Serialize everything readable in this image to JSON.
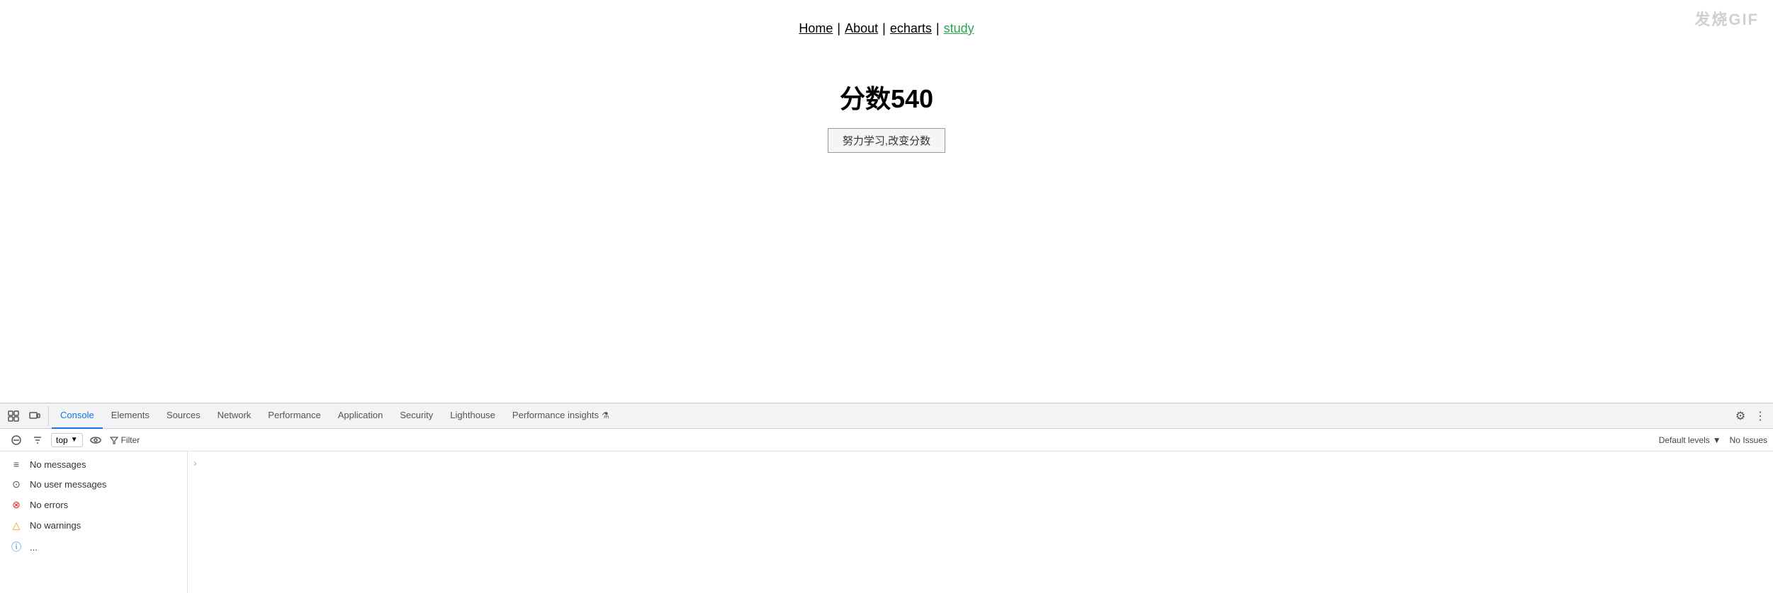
{
  "watermark": {
    "text": "发烧GIF"
  },
  "nav": {
    "links": [
      {
        "label": "Home",
        "class": "normal"
      },
      {
        "sep": "|"
      },
      {
        "label": "About",
        "class": "normal"
      },
      {
        "sep": "|"
      },
      {
        "label": "echarts",
        "class": "normal"
      },
      {
        "sep": "|"
      },
      {
        "label": "study",
        "class": "study"
      }
    ]
  },
  "score": {
    "title": "分数540",
    "button_label": "努力学习,改变分数"
  },
  "devtools": {
    "tabs": [
      {
        "label": "Console",
        "active": true
      },
      {
        "label": "Elements",
        "active": false
      },
      {
        "label": "Sources",
        "active": false
      },
      {
        "label": "Network",
        "active": false
      },
      {
        "label": "Performance",
        "active": false
      },
      {
        "label": "Application",
        "active": false
      },
      {
        "label": "Security",
        "active": false
      },
      {
        "label": "Lighthouse",
        "active": false
      },
      {
        "label": "Performance insights",
        "active": false,
        "has_icon": true
      }
    ],
    "secondary": {
      "context": "top",
      "filter_label": "Filter",
      "default_levels": "Default levels",
      "no_issues": "No Issues"
    },
    "console_items": [
      {
        "icon": "messages",
        "label": "No messages"
      },
      {
        "icon": "user",
        "label": "No user messages"
      },
      {
        "icon": "error",
        "label": "No errors"
      },
      {
        "icon": "warning",
        "label": "No warnings"
      },
      {
        "icon": "info",
        "label": "..."
      }
    ]
  }
}
